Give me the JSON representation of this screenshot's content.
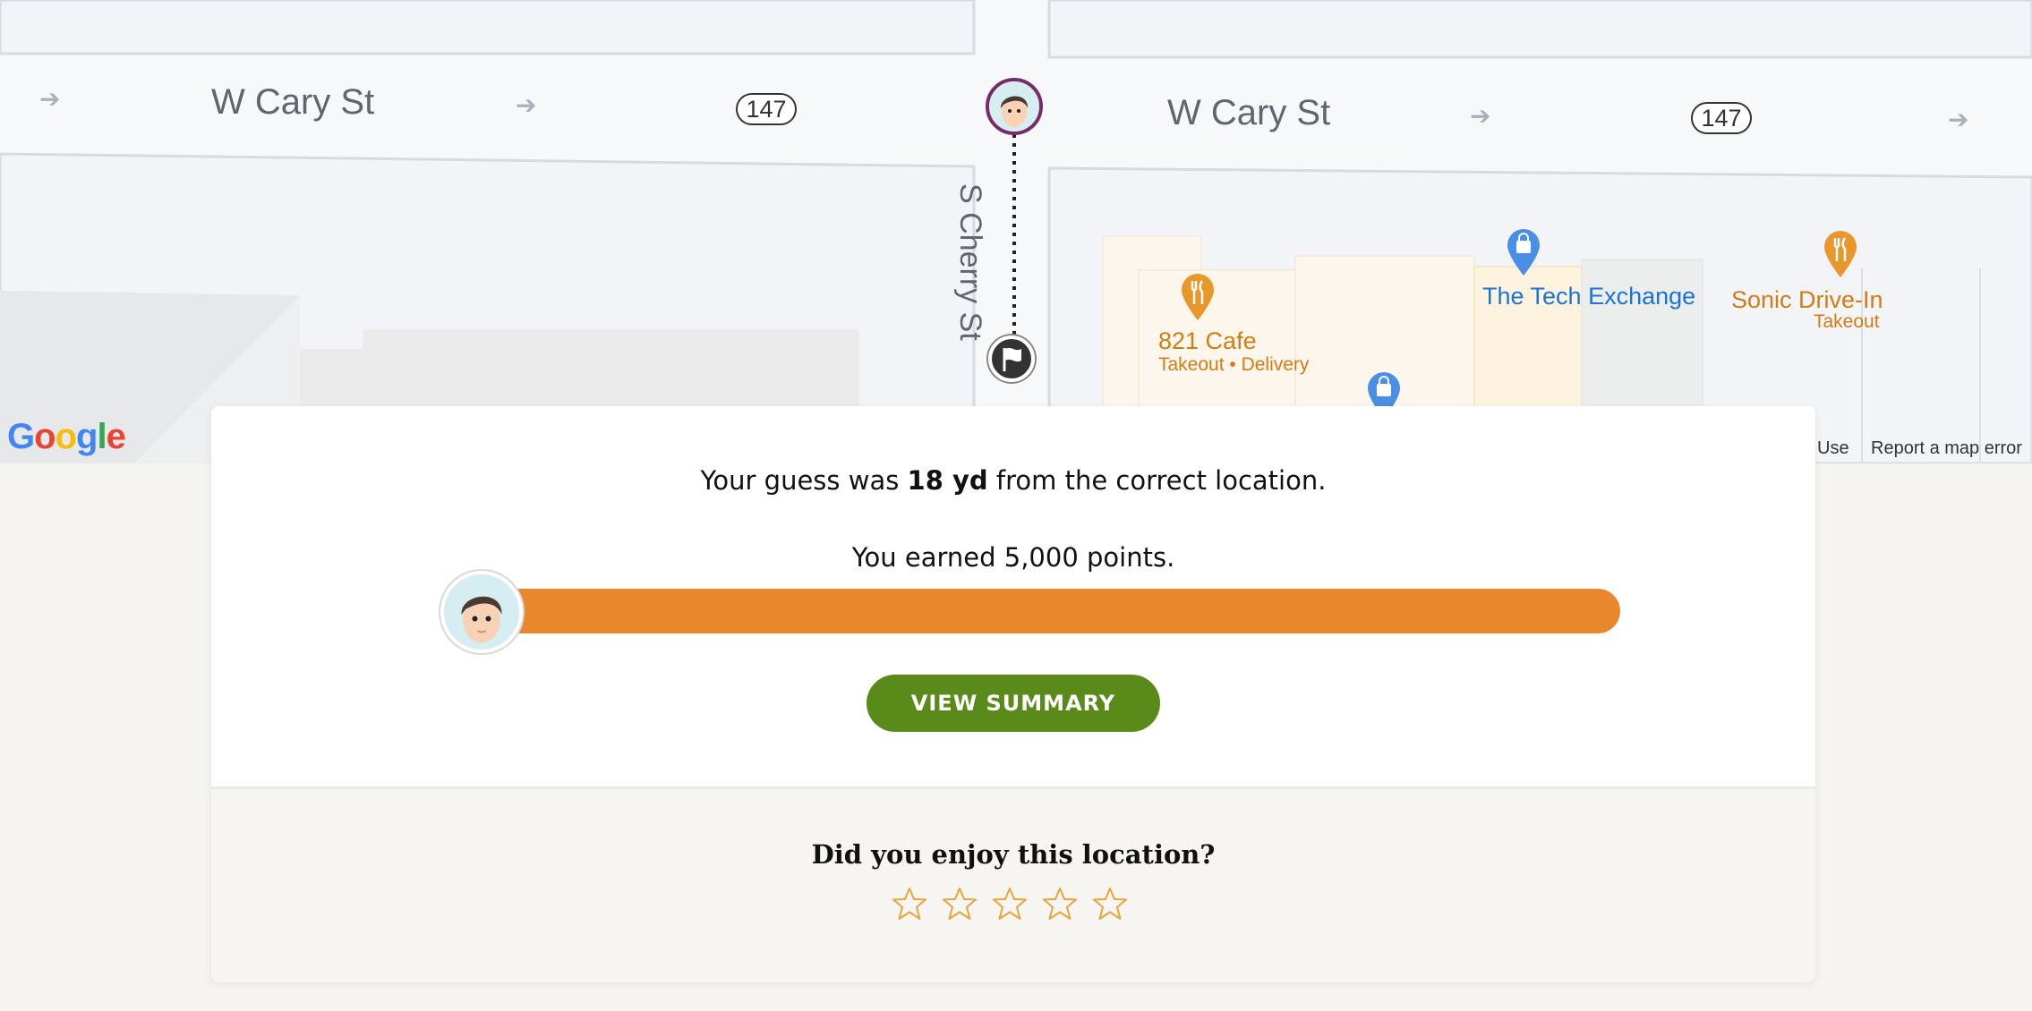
{
  "map": {
    "streets": {
      "w_cary_left": "W Cary St",
      "w_cary_right": "W Cary St",
      "s_cherry": "S Cherry St"
    },
    "route_shields": [
      "147",
      "147"
    ],
    "pois": {
      "cafe_name": "821 Cafe",
      "cafe_sub": "Takeout • Delivery",
      "tech_name": "The Tech Exchange",
      "sonic_name": "Sonic Drive-In",
      "sonic_sub": "Takeout"
    },
    "logo": "Google",
    "footer": {
      "terms": "Use",
      "report": "Report a map error"
    }
  },
  "result": {
    "guess_prefix": "Your guess was ",
    "guess_distance": "18 yd",
    "guess_suffix": " from the correct location.",
    "points_text": "You earned 5,000 points.",
    "progress_fraction": 1.0,
    "summary_button": "VIEW SUMMARY",
    "rating_question": "Did you enjoy this location?",
    "star_count": 5,
    "stars_selected": 0
  },
  "colors": {
    "progress": "#e8872b",
    "button": "#5a8a1a",
    "star_outline": "#e8a53a",
    "poi_orange": "#d27c13",
    "poi_blue": "#1a73d9"
  }
}
